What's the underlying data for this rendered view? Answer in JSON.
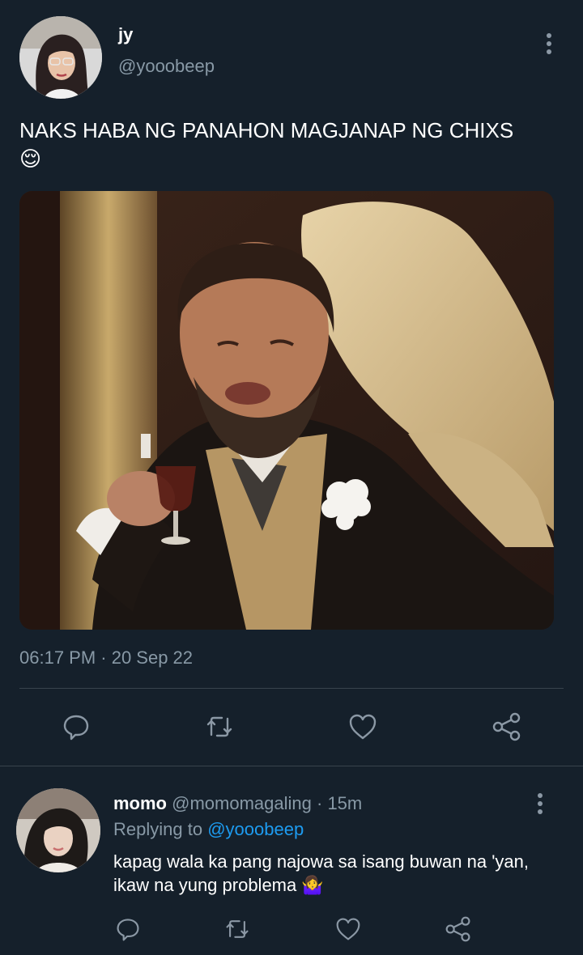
{
  "tweet": {
    "display_name": "jy",
    "handle": "@yooobeep",
    "text": "NAKS HABA NG PANAHON MAGJANAP NG CHIXS 😌",
    "timestamp": "06:17 PM · 20 Sep 22"
  },
  "reply": {
    "display_name": "momo",
    "handle": "@momomagaling",
    "time_sep": "·",
    "time": "15m",
    "replying_prefix": "Replying to",
    "replying_handle": "@yooobeep",
    "text": "kapag wala ka pang najowa sa isang buwan na 'yan, ikaw na yung problema 🤷‍♀️"
  },
  "colors": {
    "background": "#15202b",
    "muted_text": "#8899a6",
    "link": "#1d9bf0",
    "icon": "#8b98a5"
  },
  "icons": [
    "more-icon",
    "reply-icon",
    "retweet-icon",
    "like-icon",
    "share-icon"
  ]
}
